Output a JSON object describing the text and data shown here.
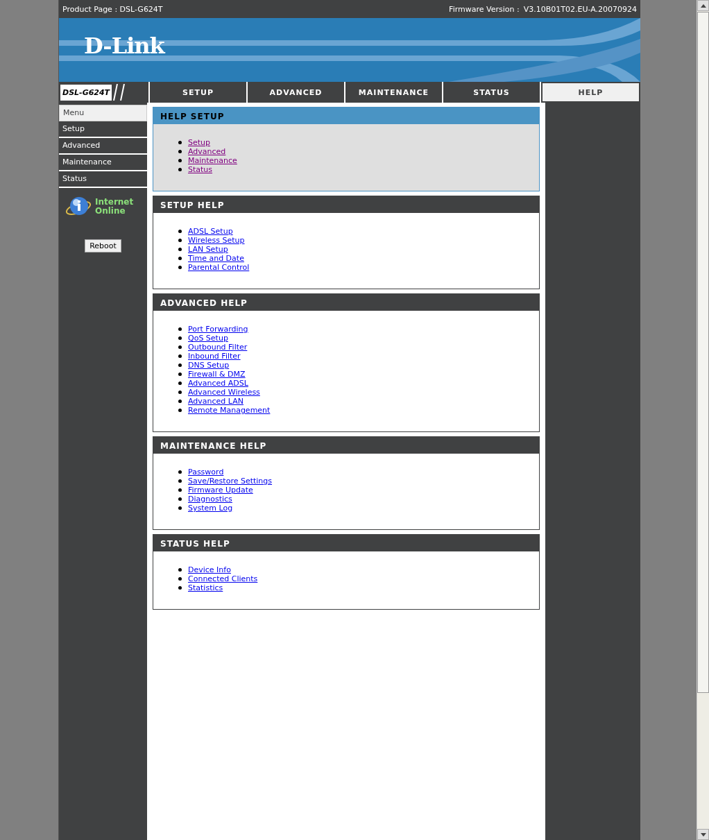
{
  "top_bar": {
    "product": "Product Page : DSL-G624T",
    "firmware_label": "Firmware Version :",
    "firmware": "V3.10B01T02.EU-A.20070924"
  },
  "logo": "D-Link",
  "model": "DSL-G624T",
  "tabs": [
    {
      "label": "SETUP",
      "selected": false
    },
    {
      "label": "ADVANCED",
      "selected": false
    },
    {
      "label": "MAINTENANCE",
      "selected": false
    },
    {
      "label": "STATUS",
      "selected": false
    },
    {
      "label": "HELP",
      "selected": true
    }
  ],
  "sidebar": {
    "items": [
      {
        "label": "Menu",
        "selected": true
      },
      {
        "label": "Setup",
        "selected": false
      },
      {
        "label": "Advanced",
        "selected": false
      },
      {
        "label": "Maintenance",
        "selected": false
      },
      {
        "label": "Status",
        "selected": false
      }
    ],
    "status": {
      "line1": "Internet",
      "line2": "Online"
    },
    "reboot": "Reboot"
  },
  "sections": [
    {
      "title": "HELP SETUP",
      "kind": "highlight",
      "links": [
        {
          "text": "Setup",
          "visited": true
        },
        {
          "text": "Advanced",
          "visited": true
        },
        {
          "text": "Maintenance",
          "visited": true
        },
        {
          "text": "Status",
          "visited": true
        }
      ]
    },
    {
      "title": "SETUP HELP",
      "kind": "normal",
      "links": [
        {
          "text": "ADSL Setup",
          "visited": false
        },
        {
          "text": "Wireless Setup",
          "visited": false
        },
        {
          "text": "LAN Setup",
          "visited": false
        },
        {
          "text": "Time and Date",
          "visited": false
        },
        {
          "text": "Parental Control",
          "visited": false
        }
      ]
    },
    {
      "title": "ADVANCED HELP",
      "kind": "normal",
      "links": [
        {
          "text": "Port Forwarding",
          "visited": false
        },
        {
          "text": "QoS Setup",
          "visited": false
        },
        {
          "text": "Outbound Filter",
          "visited": false
        },
        {
          "text": "Inbound Filter",
          "visited": false
        },
        {
          "text": "DNS Setup",
          "visited": false
        },
        {
          "text": "Firewall & DMZ",
          "visited": false
        },
        {
          "text": "Advanced ADSL",
          "visited": false
        },
        {
          "text": "Advanced Wireless",
          "visited": false
        },
        {
          "text": "Advanced LAN",
          "visited": false
        },
        {
          "text": "Remote Management",
          "visited": false
        }
      ]
    },
    {
      "title": "MAINTENANCE HELP",
      "kind": "normal",
      "links": [
        {
          "text": "Password",
          "visited": false
        },
        {
          "text": "Save/Restore Settings",
          "visited": false
        },
        {
          "text": "Firmware Update",
          "visited": false
        },
        {
          "text": "Diagnostics",
          "visited": false
        },
        {
          "text": "System Log",
          "visited": false
        }
      ]
    },
    {
      "title": "STATUS HELP",
      "kind": "normal",
      "links": [
        {
          "text": "Device Info",
          "visited": false
        },
        {
          "text": "Connected Clients",
          "visited": false
        },
        {
          "text": "Statistics",
          "visited": false
        }
      ]
    }
  ]
}
